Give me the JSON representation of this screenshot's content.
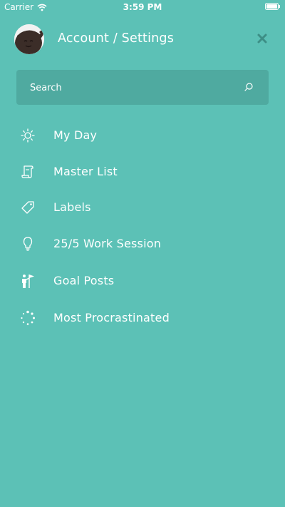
{
  "status_bar": {
    "carrier": "Carrier",
    "time": "3:59 PM"
  },
  "header": {
    "title": "Account / Settings"
  },
  "search": {
    "placeholder": "Search"
  },
  "menu": {
    "items": [
      {
        "label": "My Day",
        "icon": "sun-icon"
      },
      {
        "label": "Master List",
        "icon": "scroll-icon"
      },
      {
        "label": "Labels",
        "icon": "tag-icon"
      },
      {
        "label": "25/5 Work Session",
        "icon": "lightbulb-icon"
      },
      {
        "label": "Goal Posts",
        "icon": "goal-flag-icon"
      },
      {
        "label": "Most Procrastinated",
        "icon": "loading-dots-icon"
      }
    ]
  },
  "colors": {
    "background": "#5cc1b6",
    "search_background": "#4faaa0",
    "text": "#ffffff",
    "close_icon": "#3d8f86"
  }
}
